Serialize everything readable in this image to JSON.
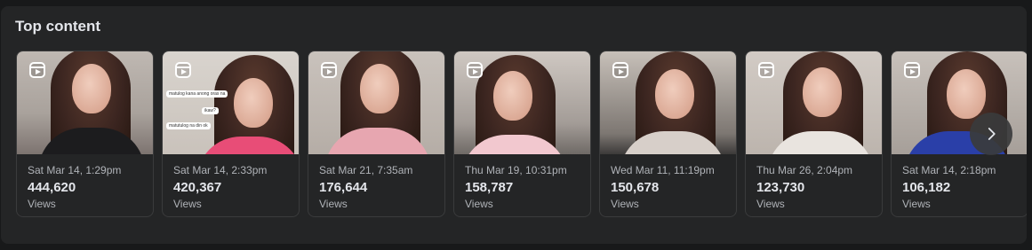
{
  "section": {
    "title": "Top content"
  },
  "cards": [
    {
      "date": "Sat Mar 14, 1:29pm",
      "views": "444,620",
      "views_label": "Views",
      "icon": "reel-icon"
    },
    {
      "date": "Sat Mar 14, 2:33pm",
      "views": "420,367",
      "views_label": "Views",
      "icon": "reel-icon",
      "overlay_text": [
        "matulog kana anong oras na",
        "ikaw?",
        "matutulog na din ok"
      ]
    },
    {
      "date": "Sat Mar 21, 7:35am",
      "views": "176,644",
      "views_label": "Views",
      "icon": "reel-icon"
    },
    {
      "date": "Thu Mar 19, 10:31pm",
      "views": "158,787",
      "views_label": "Views",
      "icon": "reel-icon"
    },
    {
      "date": "Wed Mar 11, 11:19pm",
      "views": "150,678",
      "views_label": "Views",
      "icon": "reel-icon"
    },
    {
      "date": "Thu Mar 26, 2:04pm",
      "views": "123,730",
      "views_label": "Views",
      "icon": "reel-icon"
    },
    {
      "date": "Sat Mar 14, 2:18pm",
      "views": "106,182",
      "views_label": "Views",
      "icon": "reel-icon"
    }
  ],
  "next_button": {
    "icon": "chevron-right-icon"
  },
  "colors": {
    "page_bg": "#18191a",
    "panel_bg": "#242526",
    "card_border": "#3a3b3c",
    "primary_text": "#e4e6eb",
    "secondary_text": "#b0b3b8"
  }
}
